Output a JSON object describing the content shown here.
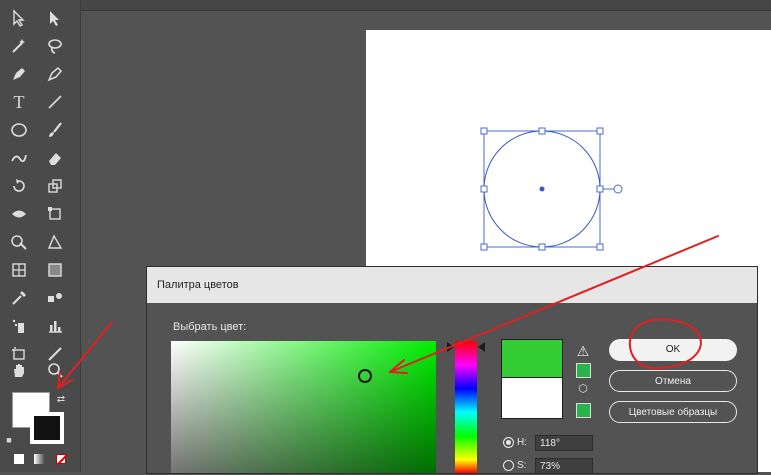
{
  "dialog": {
    "title": "Палитра цветов",
    "pick_label": "Выбрать цвет:",
    "ok_label": "OK",
    "cancel_label": "Отмена",
    "swatches_label": "Цветовые образцы",
    "h_label": "H:",
    "h_value": "118°",
    "s_label": "S:",
    "s_value": "73%"
  },
  "colors": {
    "new_color": "#33cc33",
    "old_color": "#ffffff",
    "annotation": "#e02020"
  },
  "toolbar": {
    "tools": [
      "selection-icon",
      "direct-selection-icon",
      "magic-wand-icon",
      "lasso-icon",
      "pen-icon",
      "curvature-icon",
      "type-icon",
      "line-icon",
      "ellipse-icon",
      "paintbrush-icon",
      "shaper-icon",
      "eraser-icon",
      "rotate-icon",
      "scale-icon",
      "width-icon",
      "free-transform-icon",
      "shape-builder-icon",
      "perspective-icon",
      "mesh-icon",
      "gradient-icon",
      "eyedropper-icon",
      "blend-icon",
      "symbol-sprayer-icon",
      "graph-icon",
      "artboard-icon",
      "slice-icon",
      "hand-icon",
      "zoom-icon"
    ]
  }
}
